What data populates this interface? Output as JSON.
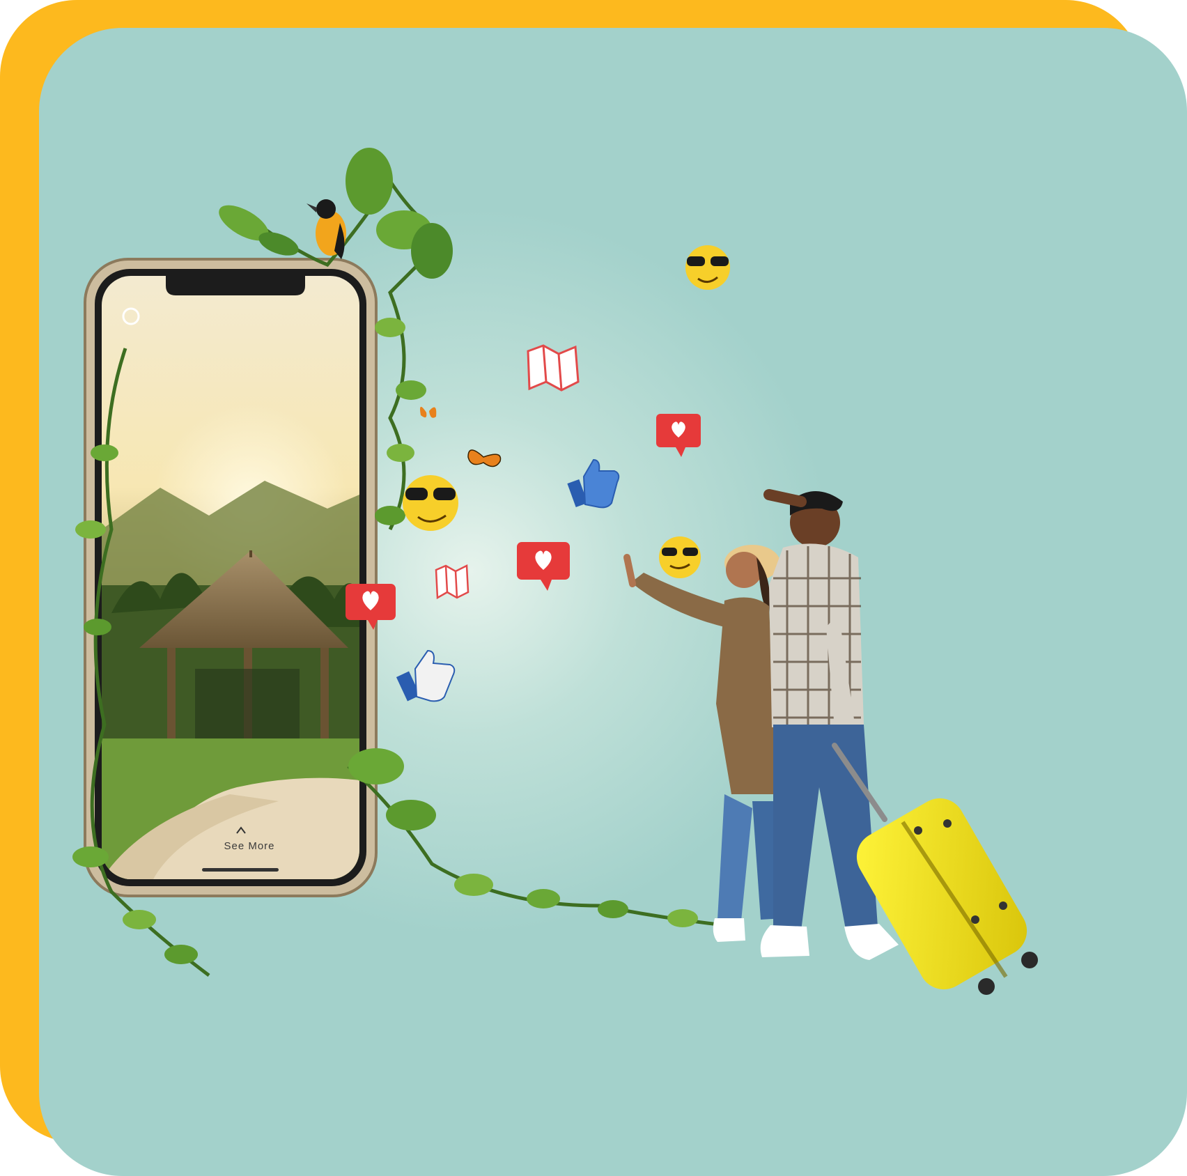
{
  "phone": {
    "see_more_label": "See More"
  },
  "colors": {
    "accent_yellow": "#FDB91E",
    "background_teal": "#A3D1CB",
    "suitcase_yellow": "#F4E51A"
  },
  "icons": [
    "sunglasses-emoji-icon",
    "map-icon",
    "heart-bubble-icon",
    "thumbs-up-icon",
    "butterfly-icon",
    "bird-icon"
  ]
}
